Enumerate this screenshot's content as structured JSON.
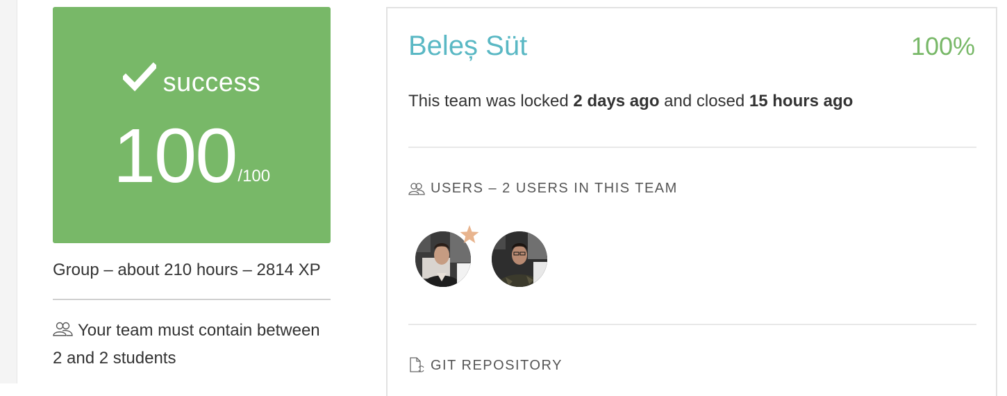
{
  "score_card": {
    "status": "success",
    "score": "100",
    "max": "/100",
    "color": "#78b868"
  },
  "project_meta": "Group – about 210 hours – 2814 XP",
  "team_rule": "Your team must contain between 2 and 2 students",
  "team": {
    "name": "Beleș Süt",
    "percent": "100%",
    "status_prefix": "This team was locked ",
    "locked": "2 days ago",
    "status_middle": " and closed ",
    "closed": "15 hours ago"
  },
  "users_section": {
    "title": "USERS – 2 USERS IN THIS TEAM",
    "users": [
      {
        "role": "leader",
        "icon": "star-icon"
      },
      {
        "role": "member"
      }
    ]
  },
  "git_section": {
    "title": "GIT REPOSITORY"
  },
  "colors": {
    "accent_green": "#78b868",
    "team_name": "#5ab8c4",
    "star": "#e8b48e"
  }
}
